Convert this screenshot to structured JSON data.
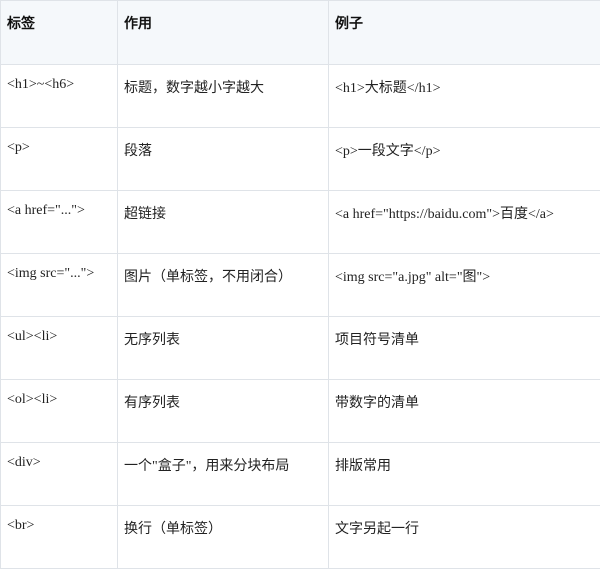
{
  "table": {
    "headers": [
      "标签",
      "作用",
      "例子"
    ],
    "rows": [
      [
        "<h1>~<h6>",
        "标题，数字越小字越大",
        "<h1>大标题</h1>"
      ],
      [
        "<p>",
        "段落",
        "<p>一段文字</p>"
      ],
      [
        "<a href=\"...\">",
        "超链接",
        "<a href=\"https://baidu.com\">百度</a>"
      ],
      [
        "<img src=\"...\">",
        "图片（单标签，不用闭合）",
        "<img src=\"a.jpg\" alt=\"图\">"
      ],
      [
        "<ul><li>",
        "无序列表",
        "项目符号清单"
      ],
      [
        "<ol><li>",
        "有序列表",
        "带数字的清单"
      ],
      [
        "<div>",
        "一个\"盒子\"，用来分块布局",
        "排版常用"
      ],
      [
        "<br>",
        "换行（单标签）",
        "文字另起一行"
      ]
    ]
  }
}
